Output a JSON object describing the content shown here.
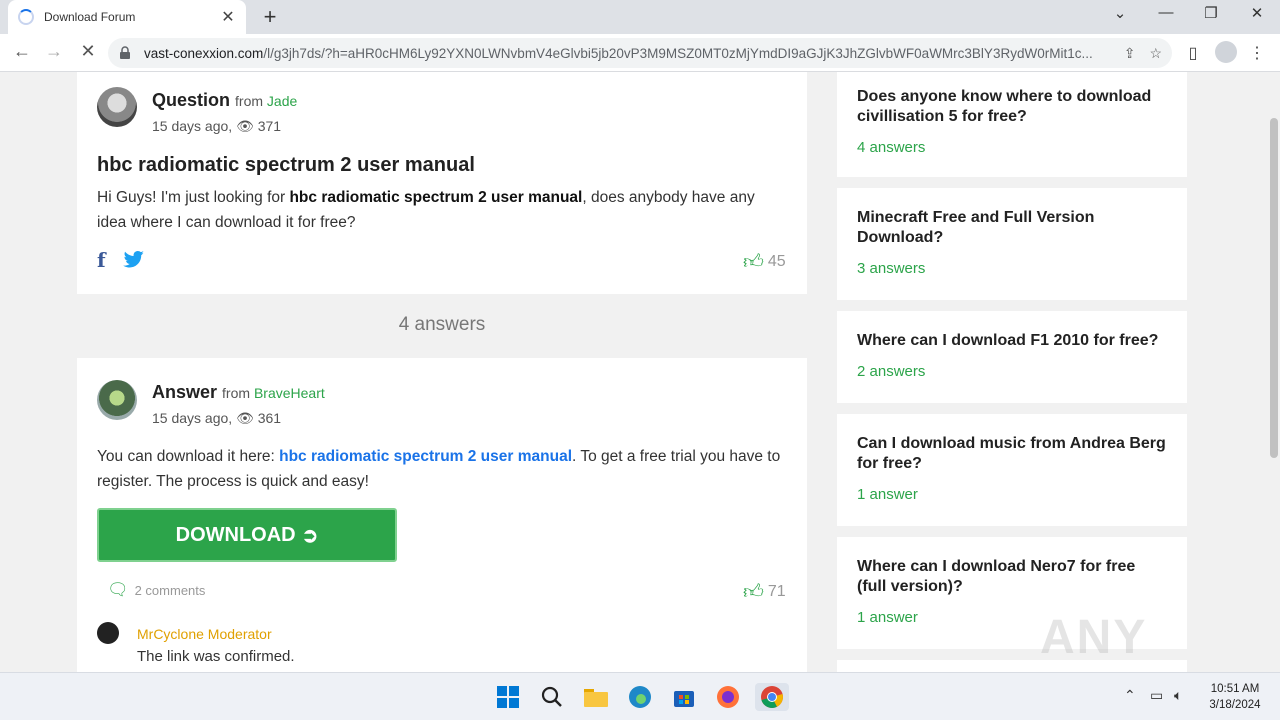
{
  "browser": {
    "tab_title": "Download Forum",
    "url_host": "vast-conexxion.com",
    "url_rest": "/l/g3jh7ds/?h=aHR0cHM6Ly92YXN0LWNvbmV4eGlvbi5jb20vP3M9MSZ0MT0zMjYmdDI9aGJjK3JhZGlvbWF0aWMrc3BlY3RydW0rMit1c..."
  },
  "question": {
    "label": "Question",
    "from": "from",
    "author": "Jade",
    "time": "15 days ago,",
    "views": "371",
    "title": "hbc radiomatic spectrum 2 user manual",
    "body_pre": "Hi Guys! I'm just looking for ",
    "body_bold": "hbc radiomatic spectrum 2 user manual",
    "body_post": ", does anybody have any idea where I can download it for free?",
    "likes": "45"
  },
  "answers_count": "4 answers",
  "answer": {
    "label": "Answer",
    "from": "from",
    "author": "BraveHeart",
    "time": "15 days ago,",
    "views": "361",
    "body_pre": "You can download it here: ",
    "body_link": "hbc radiomatic spectrum 2 user manual",
    "body_post": ". To get a free trial you have to register. The process is quick and easy!",
    "download_label": "DOWNLOAD",
    "comments": "2 comments",
    "likes": "71",
    "moderator_name": "MrCyclone Moderator",
    "moderator_text": "The link was confirmed."
  },
  "sidebar": [
    {
      "title": "Does anyone know where to download civillisation 5 for free?",
      "answers": "4 answers"
    },
    {
      "title": "Minecraft Free and Full Version Download?",
      "answers": "3 answers"
    },
    {
      "title": "Where can I download F1 2010 for free?",
      "answers": "2 answers"
    },
    {
      "title": "Can I download music from Andrea Berg for free?",
      "answers": "1 answer"
    },
    {
      "title": "Where can I download Nero7 for free (full version)?",
      "answers": "1 answer"
    }
  ],
  "watermark": "ANY RUN",
  "clock": {
    "time": "10:51 AM",
    "date": "3/18/2024"
  },
  "colors": {
    "accent": "#2ca44a",
    "link": "#1a73e8",
    "moderator": "#e0a000"
  }
}
